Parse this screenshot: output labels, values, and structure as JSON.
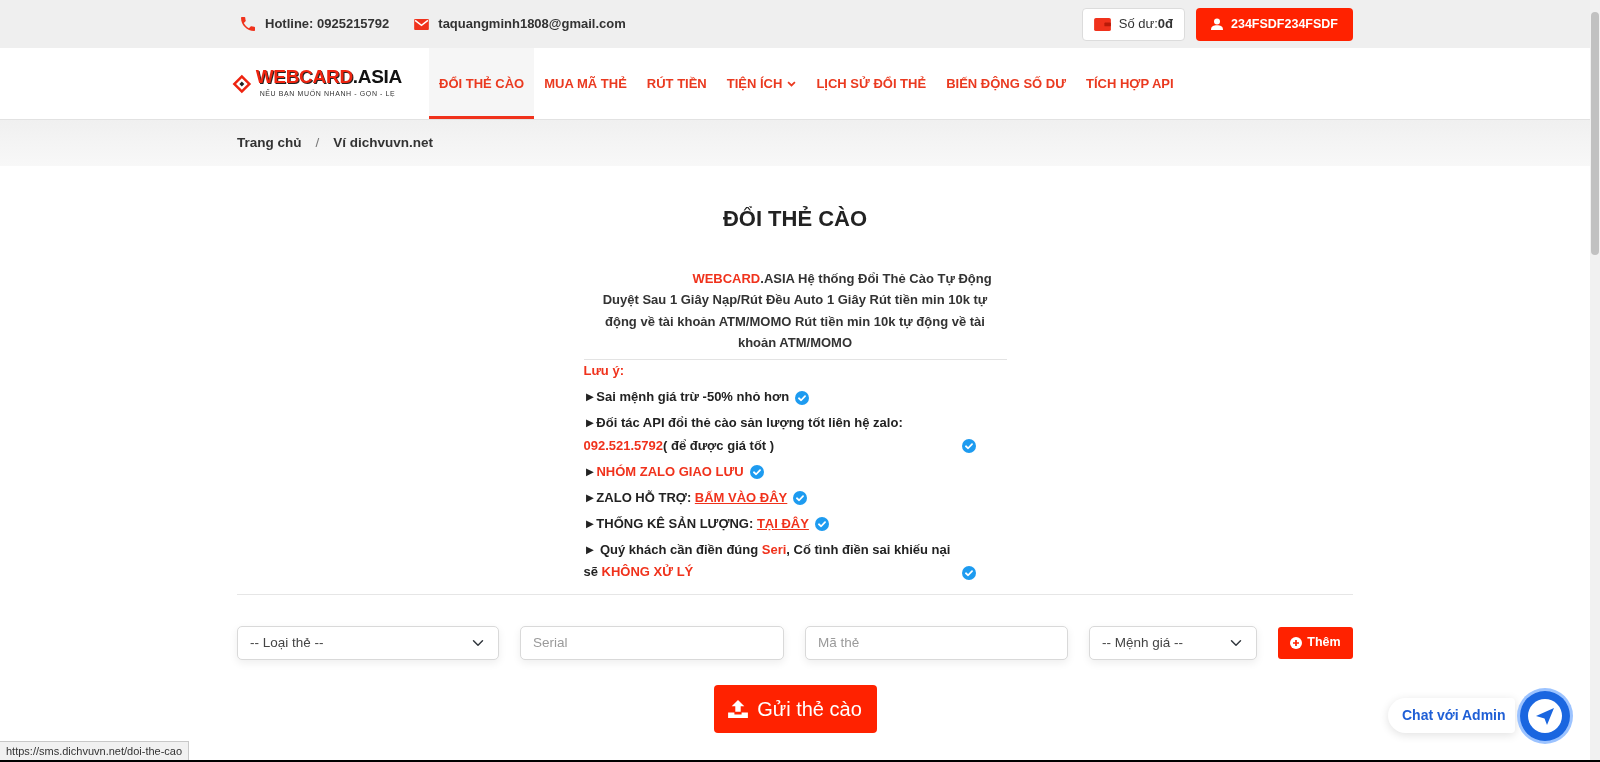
{
  "topbar": {
    "hotline": "Hotline: 0925215792",
    "email": "taquangminh1808@gmail.com",
    "balance": "Số dư:**0đ**",
    "account": "234FSDF234FSDF"
  },
  "navbar": {
    "logo": {
      "accent": "WEBCARD",
      "rest": ".ASIA",
      "tagline": "NẾU BẠN MUỐN NHANH - GỌN - LẸ"
    },
    "items": [
      {
        "label": "ĐỔI THẺ CÀO",
        "kind": "link",
        "selected": true
      },
      {
        "label": "MUA MÃ THẺ",
        "kind": "link",
        "selected": false
      },
      {
        "label": "RÚT TIỀN",
        "kind": "link",
        "selected": false
      },
      {
        "label": "TIỆN ÍCH",
        "kind": "dropdown",
        "selected": false
      },
      {
        "label": "LỊCH SỬ ĐỔI THẺ",
        "kind": "link",
        "selected": false
      },
      {
        "label": "BIẾN ĐỘNG SỐ DƯ",
        "kind": "link",
        "selected": false
      },
      {
        "label": "TÍCH HỢP API",
        "kind": "link",
        "selected": false
      }
    ]
  },
  "breadcrumb": {
    "items": [
      "Trang chủ",
      "Ví dichvuvn.net"
    ],
    "separator": "/"
  },
  "page_title": "ĐỔI THẺ CÀO",
  "intro": [
    {
      "kind": "highlight",
      "text": "WEBCARD"
    },
    {
      "kind": "text",
      "text": ".ASIA Hệ thống Đổi Thẻ Cào Tự Động Duyệt Sau 1 Giây Nạp/Rút Đều Auto 1 Giây Rút tiền min 10k tự động về tài khoản ATM/MOMO Rút tiền min 10k tự động về tài khoản ATM/MOMO"
    }
  ],
  "notes": {
    "heading": "Lưu ý:",
    "items": [
      [
        {
          "kind": "text",
          "text": "►Sai mệnh giá trừ -50% nhỏ hơn"
        }
      ],
      [
        {
          "kind": "text",
          "text": "►Đối tác API đổi thẻ cào sản lượng tốt liên hệ zalo: "
        },
        {
          "kind": "highlight",
          "text": "092.521.5792"
        },
        {
          "kind": "text",
          "text": "( để được giá tốt )"
        }
      ],
      [
        {
          "kind": "text",
          "text": "►"
        },
        {
          "kind": "highlight",
          "text": "NHÓM ZALO GIAO LƯU"
        }
      ],
      [
        {
          "kind": "text",
          "text": "►ZALO HỖ TRỢ: "
        },
        {
          "kind": "link",
          "text": "BẤM VÀO ĐÂY"
        }
      ],
      [
        {
          "kind": "text",
          "text": "►THỐNG KÊ SẢN LƯỢNG: "
        },
        {
          "kind": "link",
          "text": "TẠI ĐÂY"
        }
      ],
      [
        {
          "kind": "text",
          "text": "► Quý khách cần điền đúng "
        },
        {
          "kind": "highlight",
          "text": "Seri"
        },
        {
          "kind": "text",
          "text": ", Cố tình điền sai khiếu nại sẽ "
        },
        {
          "kind": "highlight",
          "text": "KHÔNG XỬ LÝ"
        }
      ]
    ]
  },
  "form": {
    "fields": [
      {
        "kind": "select",
        "value": "-- Loại thẻ --"
      },
      {
        "kind": "input",
        "placeholder": "Serial"
      },
      {
        "kind": "input",
        "placeholder": "Mã thẻ"
      },
      {
        "kind": "select",
        "value": "-- Mệnh giá --"
      }
    ],
    "add_button": "Thêm",
    "submit_button": "Gửi thẻ cào"
  },
  "chat_widget": {
    "label": "Chat với Admin"
  },
  "browser_status": {
    "url": "https://sms.dichvuvn.net/doi-the-cao"
  }
}
